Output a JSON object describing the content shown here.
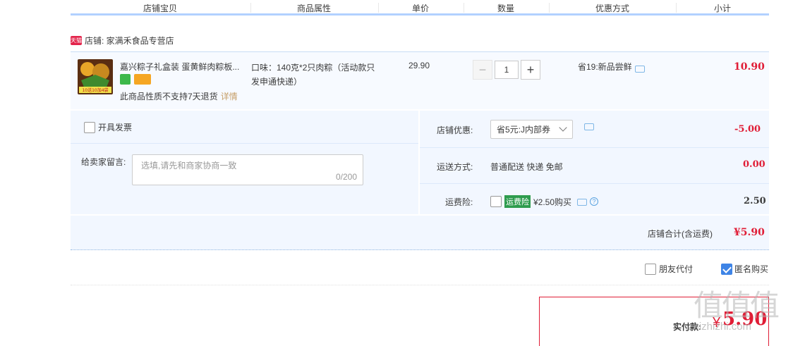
{
  "header": {
    "columns": [
      "店铺宝贝",
      "商品属性",
      "单价",
      "数量",
      "优惠方式",
      "小计"
    ]
  },
  "shop": {
    "badge": "天猫",
    "name": "店铺: 家满禾食品专营店"
  },
  "item": {
    "title": "嘉兴粽子礼盒装 蛋黄鲜肉粽板...",
    "thumb_text": "10送10加4袋",
    "property": "口味：140克*2只肉粽（活动款只发申通快递）",
    "price": "29.90",
    "quantity": "1",
    "minus": "−",
    "plus": "+",
    "promo": "省19:新品尝鲜",
    "subtotal": "10.90",
    "notice": "此商品性质不支持7天退货",
    "detail_link": "详情"
  },
  "options": {
    "invoice_label": "开具发票",
    "message_label": "给卖家留言:",
    "message_placeholder": "选填,请先和商家协商一致",
    "message_count": "0/200",
    "shop_discount_label": "店铺优惠:",
    "shop_discount_value": "省5元:J内部券",
    "shop_discount_amount": "-5.00",
    "shipping_label": "运送方式:",
    "shipping_value": "普通配送 快递 免邮",
    "shipping_amount": "0.00",
    "insurance_label": "运费险:",
    "insurance_tag": "运费险",
    "insurance_price": "¥2.50购买",
    "insurance_help": "?",
    "insurance_amount": "2.50"
  },
  "totals": {
    "shop_total_label": "店铺合计(含运费)",
    "shop_total_value": "¥5.90",
    "friend_pay": "朋友代付",
    "anonymous": "匿名购买",
    "pay_label": "实付款:",
    "pay_yen": "¥",
    "pay_amount": "5.90"
  },
  "watermark": {
    "mark": "值值值",
    "site": "zhizhizhi.com"
  },
  "colors": {
    "price_red": "#e01d36",
    "accent_blue": "#3e84e6",
    "panel_bg": "#f2f7ff"
  }
}
